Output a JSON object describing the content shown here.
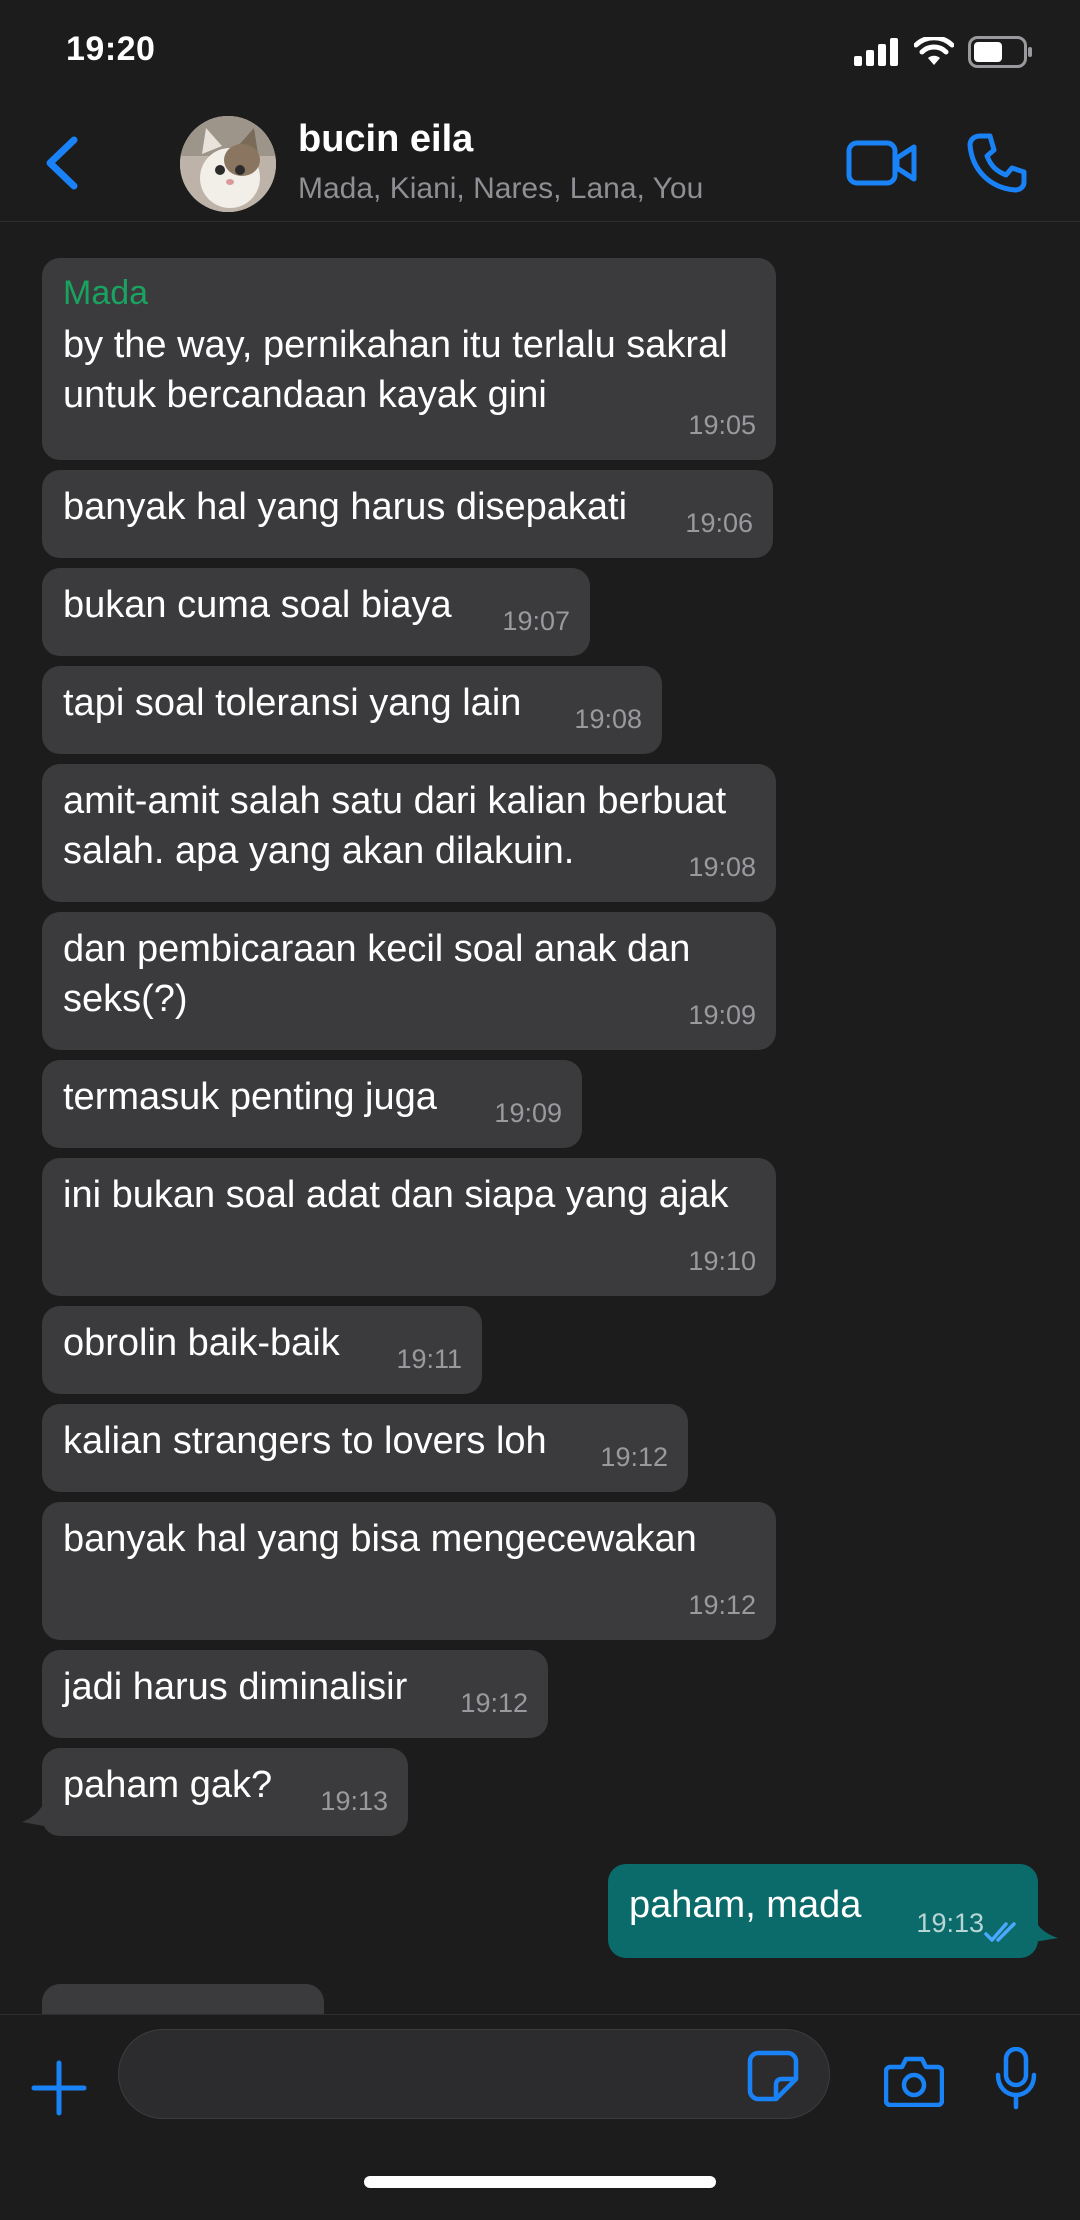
{
  "status_bar": {
    "time": "19:20"
  },
  "header": {
    "title": "bucin eila",
    "subtitle": "Mada, Kiani, Nares, Lana, You"
  },
  "messages": [
    {
      "sender": "Mada",
      "lines": [
        "by the way, pernikahan itu terlalu sakral",
        "untuk bercandaan kayak gini"
      ],
      "time": "19:05"
    },
    {
      "lines": [
        "banyak hal yang harus disepakati"
      ],
      "time": "19:06"
    },
    {
      "lines": [
        "bukan cuma soal biaya"
      ],
      "time": "19:07"
    },
    {
      "lines": [
        "tapi soal toleransi yang lain"
      ],
      "time": "19:08"
    },
    {
      "lines": [
        "amit-amit salah satu dari kalian berbuat",
        "salah. apa yang akan dilakuin."
      ],
      "time": "19:08"
    },
    {
      "lines": [
        "dan pembicaraan kecil soal anak dan",
        "seks(?)"
      ],
      "time": "19:09"
    },
    {
      "lines": [
        "termasuk penting juga"
      ],
      "time": "19:09"
    },
    {
      "lines": [
        "ini bukan soal adat dan siapa yang ajak"
      ],
      "time": "19:10"
    },
    {
      "lines": [
        "obrolin baik-baik"
      ],
      "time": "19:11"
    },
    {
      "lines": [
        "kalian strangers to lovers loh"
      ],
      "time": "19:12"
    },
    {
      "lines": [
        "banyak hal yang bisa mengecewakan"
      ],
      "time": "19:12"
    },
    {
      "lines": [
        "jadi harus diminalisir"
      ],
      "time": "19:12"
    },
    {
      "lines": [
        "paham gak?"
      ],
      "time": "19:13"
    }
  ],
  "outgoing": {
    "text": "paham, mada",
    "time": "19:13",
    "status": "read"
  },
  "input": {
    "placeholder": ""
  },
  "colors": {
    "accent": "#1a82f7",
    "sender_name": "#1aa260",
    "incoming_bubble": "#3b3b3d",
    "outgoing_bubble": "#0b6a6a"
  }
}
